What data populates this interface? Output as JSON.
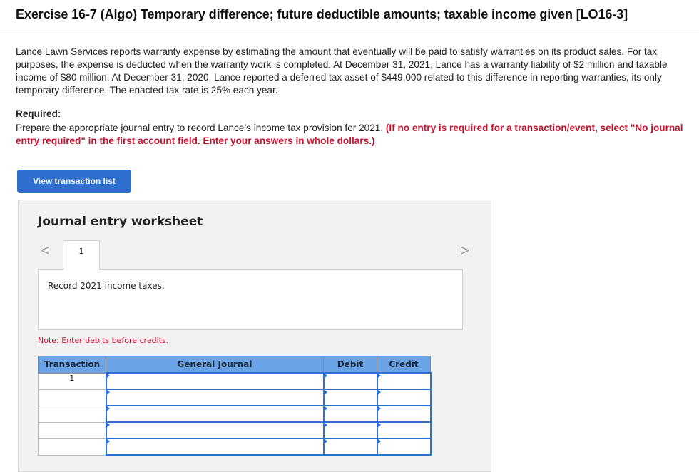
{
  "title": "Exercise 16-7 (Algo) Temporary difference; future deductible amounts; taxable income given [LO16-3]",
  "intro": "Lance Lawn Services reports warranty expense by estimating the amount that eventually will be paid to satisfy warranties on its product sales. For tax purposes, the expense is deducted when the warranty work is completed. At December 31, 2021, Lance has a warranty liability of $2 million and taxable income of $80 million. At December 31, 2020, Lance reported a deferred tax asset of $449,000 related to this difference in reporting warranties, its only temporary difference. The enacted tax rate is 25% each year.",
  "required": {
    "label": "Required:",
    "text": "Prepare the appropriate journal entry to record Lance’s income tax provision for 2021.",
    "instruction": "(If no entry is required for a transaction/event, select \"No journal entry required\" in the first account field. Enter your answers in whole dollars.)"
  },
  "view_button": "View transaction list",
  "worksheet": {
    "title": "Journal entry worksheet",
    "nav_prev": "<",
    "nav_next": ">",
    "tab_label": "1",
    "description": "Record 2021 income taxes.",
    "note": "Note: Enter debits before credits."
  },
  "journal": {
    "headers": [
      "Transaction",
      "General Journal",
      "Debit",
      "Credit"
    ],
    "rows": [
      {
        "transaction": "1",
        "account": "",
        "debit": "",
        "credit": ""
      },
      {
        "transaction": "",
        "account": "",
        "debit": "",
        "credit": ""
      },
      {
        "transaction": "",
        "account": "",
        "debit": "",
        "credit": ""
      },
      {
        "transaction": "",
        "account": "",
        "debit": "",
        "credit": ""
      },
      {
        "transaction": "",
        "account": "",
        "debit": "",
        "credit": ""
      }
    ]
  },
  "colors": {
    "accent": "#2e6fd0",
    "header_fill": "#6aa4e6",
    "instruction_red": "#c8102e"
  }
}
